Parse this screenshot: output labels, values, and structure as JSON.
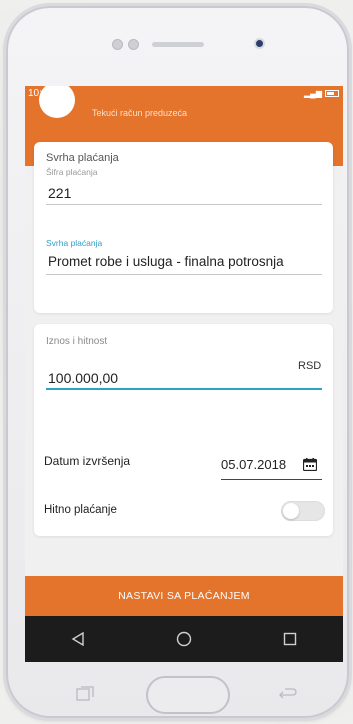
{
  "status_bar": {
    "time": "10:10"
  },
  "header": {
    "account_subtitle": "Tekući račun preduzeća"
  },
  "purpose_card": {
    "section_title": "Svrha plaćanja",
    "code_label": "Šifra plaćanja",
    "code_value": "221",
    "purpose_label": "Svrha plaćanja",
    "purpose_value": "Promet robe i usluga - finalna potrosnja"
  },
  "amount_card": {
    "section_title": "Iznos i hitnost",
    "currency": "RSD",
    "amount_value": "100.000,00",
    "date_label": "Datum izvršenja",
    "date_value": "05.07.2018",
    "urgent_label": "Hitno plaćanje",
    "urgent_on": false
  },
  "cta": {
    "label": "NASTAVI SA PLAĆANJEM"
  },
  "colors": {
    "accent": "#e4732b",
    "focus": "#2fa0c6",
    "nav": "#1c1c1c"
  },
  "icons": [
    "signal-icon",
    "battery-icon",
    "calendar-icon",
    "back-icon",
    "home-icon",
    "recents-icon"
  ]
}
